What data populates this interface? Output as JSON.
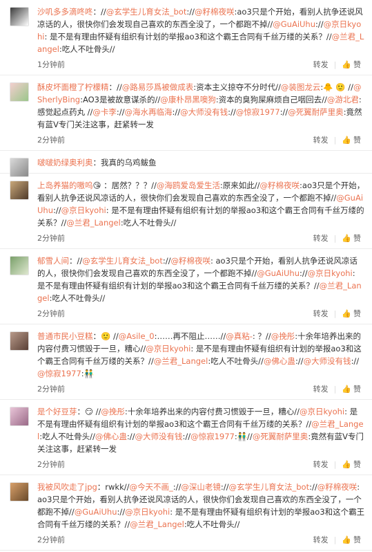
{
  "ui": {
    "forward_label": "转发",
    "like_label": "赞",
    "separator": "|"
  },
  "comments": [
    {
      "avatar_colors": [
        "#3c3c3c",
        "#ffffff"
      ],
      "time": "1分钟前",
      "segments": [
        {
          "cls": "user",
          "text": "沙叽多多滴咚咚"
        },
        {
          "cls": "plain",
          "text": "：//"
        },
        {
          "cls": "tag",
          "text": "@玄学生儿育女法_bot"
        },
        {
          "cls": "plain",
          "text": "://"
        },
        {
          "cls": "tag",
          "text": "@籽棉夜咲"
        },
        {
          "cls": "plain",
          "text": ":ao3只是个开始，看别人抗争还说风凉话的人，很快你们会发现自己喜欢的东西全没了，一个都跑不掉//"
        },
        {
          "cls": "tag",
          "text": "@GuAiUhu"
        },
        {
          "cls": "plain",
          "text": "://"
        },
        {
          "cls": "tag",
          "text": "@京日kyohi"
        },
        {
          "cls": "plain",
          "text": ": 是不是有理由怀疑有组织有计划的举报ao3和这个霸王合同有千丝万缕的关系？//"
        },
        {
          "cls": "tag",
          "text": "@兰君_Langel"
        },
        {
          "cls": "plain",
          "text": ":吃人不吐骨头//"
        }
      ]
    },
    {
      "avatar_colors": [
        "#f3cfcf",
        "#9bc68a"
      ],
      "time": "2分钟前",
      "segments": [
        {
          "cls": "user",
          "text": "酥皮坏面橙了柠檬精"
        },
        {
          "cls": "plain",
          "text": "：//"
        },
        {
          "cls": "tag",
          "text": "@路易莎爲被做成表"
        },
        {
          "cls": "plain",
          "text": ":资本主义掠夺不分时代//"
        },
        {
          "cls": "tag",
          "text": "@装图龙云"
        },
        {
          "cls": "plain",
          "text": ":🐥 🙂 //"
        },
        {
          "cls": "tag",
          "text": "@SherlyBing"
        },
        {
          "cls": "plain",
          "text": ":AO3是被故意谋杀的//"
        },
        {
          "cls": "tag",
          "text": "@康朴昂黑噢狗"
        },
        {
          "cls": "plain",
          "text": ":资本的臭狗屎麻烦自己咽回去//"
        },
        {
          "cls": "tag",
          "text": "@游北君"
        },
        {
          "cls": "plain",
          "text": ":感觉起点药丸 //"
        },
        {
          "cls": "tag",
          "text": "@卡李"
        },
        {
          "cls": "plain",
          "text": "://"
        },
        {
          "cls": "tag",
          "text": "@海水再临海"
        },
        {
          "cls": "plain",
          "text": "://"
        },
        {
          "cls": "tag",
          "text": "@大师没有钱"
        },
        {
          "cls": "plain",
          "text": "://"
        },
        {
          "cls": "tag",
          "text": "@惊寂1977"
        },
        {
          "cls": "plain",
          "text": "://"
        },
        {
          "cls": "tag",
          "text": "@死翼耐萨里奥"
        },
        {
          "cls": "plain",
          "text": ":竟然有蓝V专门关注这事，赶紧转一发"
        }
      ]
    },
    {
      "avatar_colors": [
        "#d9d9d9",
        "#8a8a8a"
      ],
      "time": "",
      "segments": [
        {
          "cls": "user",
          "text": "啵啵奶绿奥利奥"
        },
        {
          "cls": "plain",
          "text": "：我真的乌鸡鲅鱼"
        }
      ]
    },
    {
      "avatar_colors": [
        "#c9a87a",
        "#4f3a2a"
      ],
      "time": "2分钟前",
      "segments": [
        {
          "cls": "user",
          "text": "上岛养猫的嗷呜"
        },
        {
          "cls": "plain",
          "text": "😘 ：居然？？？//"
        },
        {
          "cls": "tag",
          "text": "@海鸥爱岛爱生活"
        },
        {
          "cls": "plain",
          "text": ":原来如此//"
        },
        {
          "cls": "tag",
          "text": "@籽棉夜咲"
        },
        {
          "cls": "plain",
          "text": ":ao3只是个开始，看别人抗争还说风凉话的人，很快你们会发现自己喜欢的东西全没了，一个都跑不掉//"
        },
        {
          "cls": "tag",
          "text": "@GuAiUhu"
        },
        {
          "cls": "plain",
          "text": "://"
        },
        {
          "cls": "tag",
          "text": "@京日kyohi"
        },
        {
          "cls": "plain",
          "text": ": 是不是有理由怀疑有组织有计划的举报ao3和这个霸王合同有千丝万缕的关系？//"
        },
        {
          "cls": "tag",
          "text": "@兰君_Langel"
        },
        {
          "cls": "plain",
          "text": ":吃人不吐骨头//"
        }
      ]
    },
    {
      "avatar_colors": [
        "#7aa06a",
        "#dfe8d0"
      ],
      "time": "2分钟前",
      "segments": [
        {
          "cls": "user",
          "text": "郁雪人间"
        },
        {
          "cls": "plain",
          "text": "：//"
        },
        {
          "cls": "tag",
          "text": "@玄学生儿育女法_bot"
        },
        {
          "cls": "plain",
          "text": "://"
        },
        {
          "cls": "tag",
          "text": "@籽棉夜咲"
        },
        {
          "cls": "plain",
          "text": ": ao3只是个开始，看别人抗争还说风凉话的人，很快你们会发现自己喜欢的东西全没了，一个都跑不掉//"
        },
        {
          "cls": "tag",
          "text": "@GuAiUhu"
        },
        {
          "cls": "plain",
          "text": "://"
        },
        {
          "cls": "tag",
          "text": "@京日kyohi"
        },
        {
          "cls": "plain",
          "text": ": 是不是有理由怀疑有组织有计划的举报ao3和这个霸王合同有千丝万缕的关系？//"
        },
        {
          "cls": "tag",
          "text": "@兰君_Langel"
        },
        {
          "cls": "plain",
          "text": ":吃人不吐骨头//"
        }
      ]
    },
    {
      "avatar_colors": [
        "#b89a8a",
        "#5a4036"
      ],
      "time": "2分钟前",
      "segments": [
        {
          "cls": "user",
          "text": "普通市民小豆糕"
        },
        {
          "cls": "plain",
          "text": "：🙂 //"
        },
        {
          "cls": "tag",
          "text": "@Asile_0"
        },
        {
          "cls": "plain",
          "text": ":……再不阻止……//"
        },
        {
          "cls": "tag",
          "text": "@真粘-"
        },
        {
          "cls": "plain",
          "text": ": ？//"
        },
        {
          "cls": "tag",
          "text": "@挽彤"
        },
        {
          "cls": "plain",
          "text": ":十余年培养出来的内容付费习惯毁于一旦，糟心//"
        },
        {
          "cls": "tag",
          "text": "@京日kyohi"
        },
        {
          "cls": "plain",
          "text": ": 是不是有理由怀疑有组织有计划的举报ao3和这个霸王合同有千丝万缕的关系？//"
        },
        {
          "cls": "tag",
          "text": "@兰君_Langel"
        },
        {
          "cls": "plain",
          "text": ":吃人不吐骨头//"
        },
        {
          "cls": "tag",
          "text": "@佛心蛊"
        },
        {
          "cls": "plain",
          "text": "://"
        },
        {
          "cls": "tag",
          "text": "@大师没有钱"
        },
        {
          "cls": "plain",
          "text": "://"
        },
        {
          "cls": "tag",
          "text": "@惊寂1977"
        },
        {
          "cls": "plain",
          "text": ":👬"
        }
      ]
    },
    {
      "avatar_colors": [
        "#e9c5d8",
        "#9a6a88"
      ],
      "time": "2分钟前",
      "segments": [
        {
          "cls": "user",
          "text": "是个好豆芽"
        },
        {
          "cls": "plain",
          "text": "：😏 //"
        },
        {
          "cls": "tag",
          "text": "@挽彤"
        },
        {
          "cls": "plain",
          "text": ":十余年培养出来的内容付费习惯毁于一旦，糟心//"
        },
        {
          "cls": "tag",
          "text": "@京日kyohi"
        },
        {
          "cls": "plain",
          "text": ": 是不是有理由怀疑有组织有计划的举报ao3和这个霸王合同有千丝万缕的关系？//"
        },
        {
          "cls": "tag",
          "text": "@兰君_Langel"
        },
        {
          "cls": "plain",
          "text": ":吃人不吐骨头//"
        },
        {
          "cls": "tag",
          "text": "@佛心蛊"
        },
        {
          "cls": "plain",
          "text": "://"
        },
        {
          "cls": "tag",
          "text": "@大师没有钱"
        },
        {
          "cls": "plain",
          "text": "://"
        },
        {
          "cls": "tag",
          "text": "@惊寂1977"
        },
        {
          "cls": "plain",
          "text": ":👬//"
        },
        {
          "cls": "tag",
          "text": "@死翼耐萨里奥"
        },
        {
          "cls": "plain",
          "text": ":竟然有蓝V专门关注这事，赶紧转一发"
        }
      ]
    },
    {
      "avatar_colors": [
        "#d8a06a",
        "#6a4a2a"
      ],
      "time": "2分钟前",
      "segments": [
        {
          "cls": "user",
          "text": "我被风吹走了jpg"
        },
        {
          "cls": "plain",
          "text": "：rwkk//"
        },
        {
          "cls": "tag",
          "text": "@今天不画_"
        },
        {
          "cls": "plain",
          "text": "://"
        },
        {
          "cls": "tag",
          "text": "@深山老镜"
        },
        {
          "cls": "plain",
          "text": "://"
        },
        {
          "cls": "tag",
          "text": "@玄学生儿育女法_bot"
        },
        {
          "cls": "plain",
          "text": "://"
        },
        {
          "cls": "tag",
          "text": "@籽棉夜咲"
        },
        {
          "cls": "plain",
          "text": ": ao3只是个开始，看别人抗争还说风凉话的人，很快你们会发现自己喜欢的东西全没了，一个都跑不掉//"
        },
        {
          "cls": "tag",
          "text": "@GuAiUhu"
        },
        {
          "cls": "plain",
          "text": "://"
        },
        {
          "cls": "tag",
          "text": "@京日kyohi"
        },
        {
          "cls": "plain",
          "text": ": 是不是有理由怀疑有组织有计划的举报ao3和这个霸王合同有千丝万缕的关系？//"
        },
        {
          "cls": "tag",
          "text": "@兰君_Langel"
        },
        {
          "cls": "plain",
          "text": ":吃人不吐骨头//"
        }
      ]
    }
  ]
}
